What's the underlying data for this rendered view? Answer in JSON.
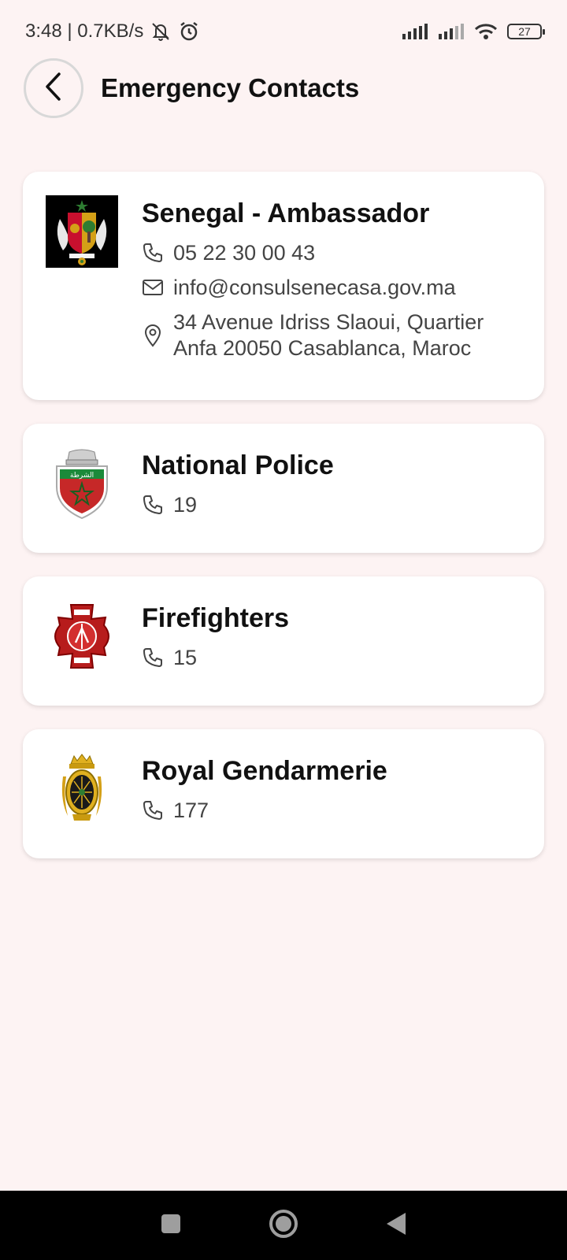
{
  "status_bar": {
    "time_speed": "3:48 | 0.7KB/s",
    "battery": "27"
  },
  "header": {
    "title": "Emergency Contacts"
  },
  "contacts": [
    {
      "name": "Senegal - Ambassador",
      "phone": "05 22 30 00 43",
      "email": "info@consulsenecasa.gov.ma",
      "address_line1": "34 Avenue Idriss Slaoui, Quartier",
      "address_line2": "Anfa 20050 Casablanca, Maroc",
      "logo": "senegal-coat-of-arms-icon"
    },
    {
      "name": "National Police",
      "phone": "19",
      "logo": "police-badge-icon"
    },
    {
      "name": "Firefighters",
      "phone": "15",
      "logo": "fire-department-cross-icon"
    },
    {
      "name": "Royal Gendarmerie",
      "phone": "177",
      "logo": "gendarmerie-emblem-icon"
    }
  ],
  "colors": {
    "background": "#fdf3f3",
    "card": "#ffffff",
    "nav_bar": "#000000"
  }
}
